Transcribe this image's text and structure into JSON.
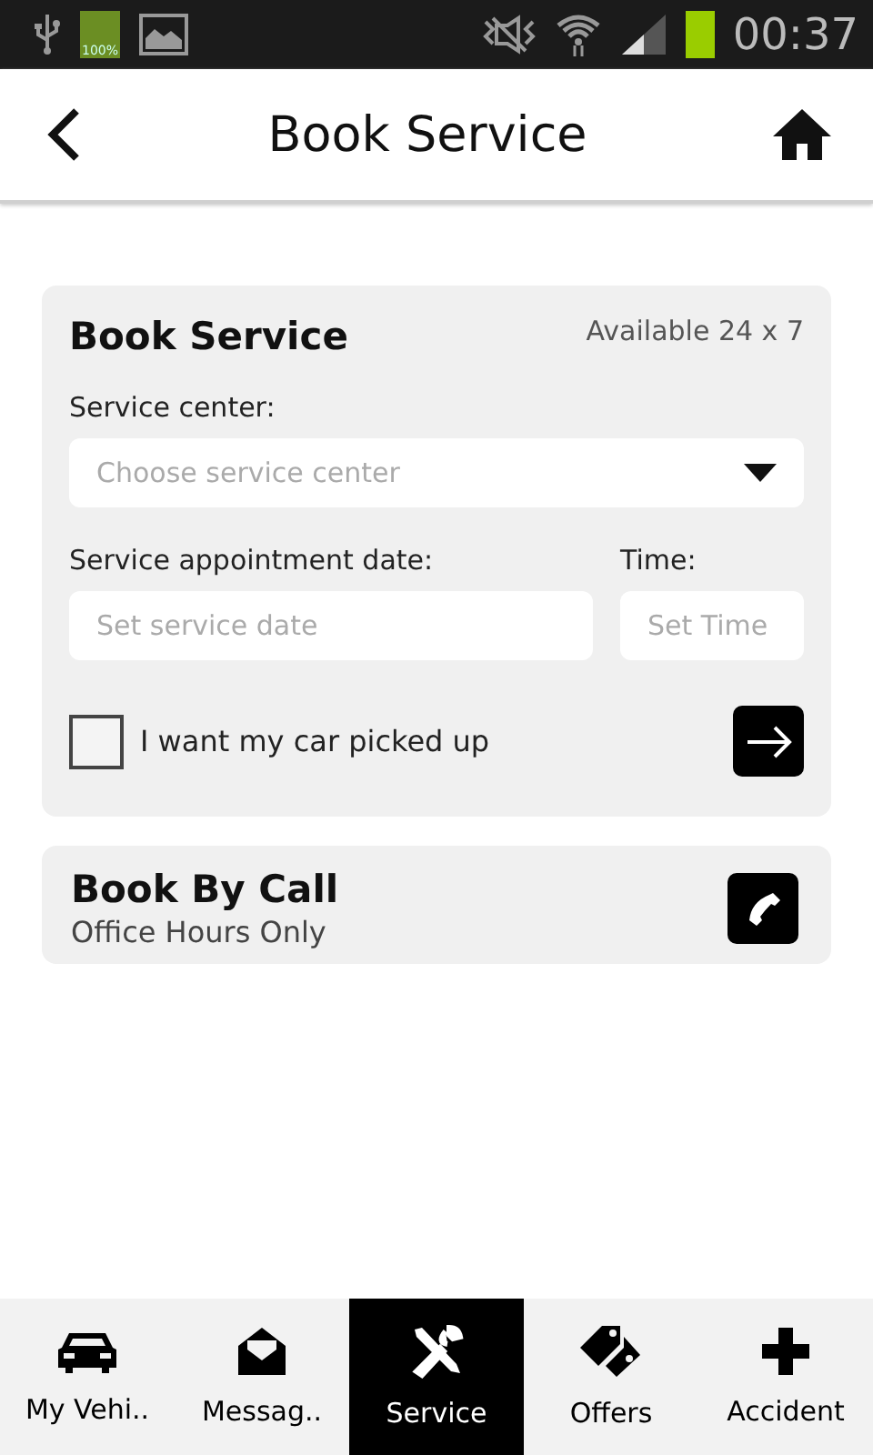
{
  "status_bar": {
    "battery_text": "100%",
    "time": "00:37"
  },
  "header": {
    "title": "Book Service"
  },
  "book_service": {
    "title": "Book Service",
    "availability": "Available 24 x 7",
    "service_center": {
      "label": "Service center:",
      "placeholder": "Choose service center"
    },
    "date": {
      "label": "Service appointment date:",
      "placeholder": "Set service date"
    },
    "time": {
      "label": "Time:",
      "placeholder": "Set Time"
    },
    "pickup": {
      "label": "I want my car picked up",
      "checked": false
    }
  },
  "book_by_call": {
    "title": "Book By Call",
    "subtitle": "Office Hours Only"
  },
  "tabs": [
    {
      "label": "My Vehi..",
      "kind": "car",
      "selected": false
    },
    {
      "label": "Messag..",
      "kind": "mail",
      "selected": false
    },
    {
      "label": "Service",
      "kind": "tools",
      "selected": true
    },
    {
      "label": "Offers",
      "kind": "tags",
      "selected": false
    },
    {
      "label": "Accident",
      "kind": "plus",
      "selected": false
    }
  ]
}
